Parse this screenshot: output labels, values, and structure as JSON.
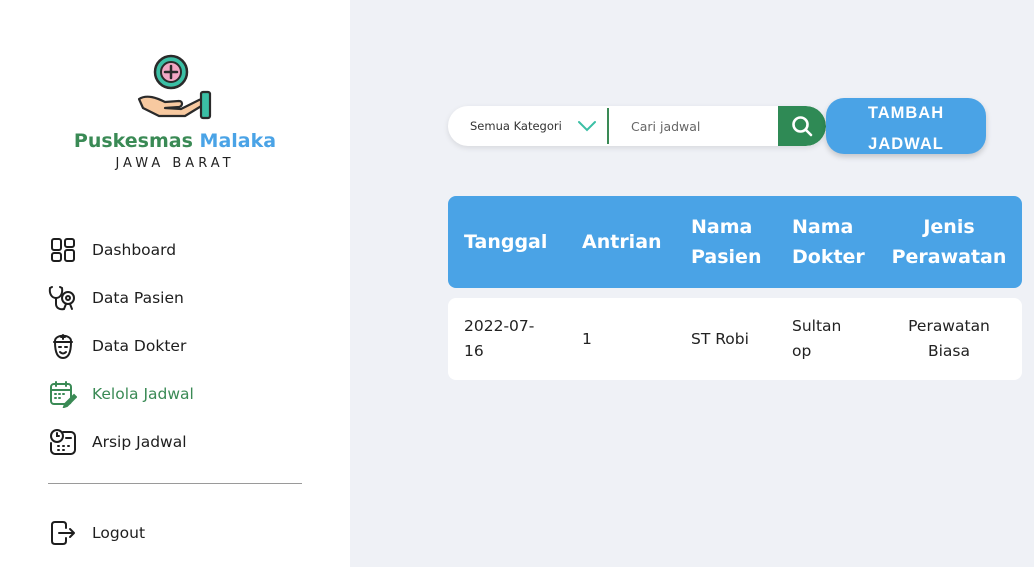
{
  "brand": {
    "name_part1": "Puskesmas",
    "name_part2": "Malaka",
    "subtitle": "JAWA BARAT"
  },
  "sidebar": {
    "items": [
      {
        "label": "Dashboard",
        "icon": "dashboard-icon"
      },
      {
        "label": "Data Pasien",
        "icon": "stethoscope-icon"
      },
      {
        "label": "Data Dokter",
        "icon": "doctor-icon"
      },
      {
        "label": "Kelola Jadwal",
        "icon": "calendar-edit-icon",
        "active": true
      },
      {
        "label": "Arsip Jadwal",
        "icon": "schedule-archive-icon"
      }
    ],
    "logout_label": "Logout"
  },
  "search": {
    "category": "Semua Kategori",
    "placeholder": "Cari jadwal"
  },
  "add_button": {
    "line1": "TAMBAH",
    "line2": "JADWAL"
  },
  "table": {
    "headers": [
      [
        "Tanggal"
      ],
      [
        "Antrian"
      ],
      [
        "Nama",
        "Pasien"
      ],
      [
        "Nama",
        "Dokter"
      ],
      [
        "Jenis",
        "Perawatan"
      ]
    ],
    "rows": [
      {
        "tanggal": [
          "2022-07-",
          "16"
        ],
        "antrian": "1",
        "nama_pasien": "ST Robi",
        "nama_dokter": [
          "Sultan",
          "op"
        ],
        "jenis_perawatan": [
          "Perawatan",
          "Biasa"
        ]
      }
    ]
  },
  "colors": {
    "green": "#3a8a55",
    "blue": "#4aa3e6",
    "background": "#eff1f6"
  }
}
